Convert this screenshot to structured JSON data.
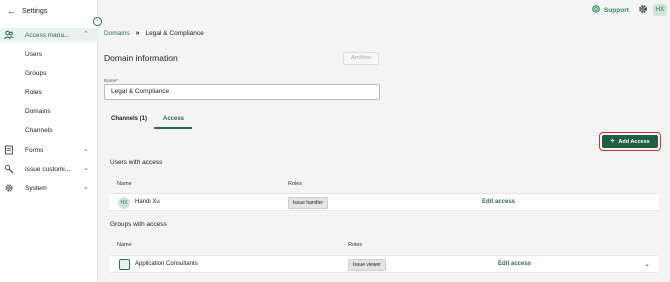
{
  "sidebar": {
    "back_label": "Settings",
    "sections": [
      {
        "label": "Access mana...",
        "icon": "users-icon",
        "expanded": true
      },
      {
        "label": "Forms",
        "icon": "forms-icon",
        "expanded": false
      },
      {
        "label": "Issue customi...",
        "icon": "tools-icon",
        "expanded": false
      },
      {
        "label": "System",
        "icon": "gear-icon",
        "expanded": false
      }
    ],
    "subitems": [
      "Users",
      "Groups",
      "Roles",
      "Domains",
      "Channels"
    ]
  },
  "topbar": {
    "support_label": "Support",
    "avatar_initials": "HX"
  },
  "breadcrumb": {
    "parent": "Domains",
    "current": "Legal & Compliance"
  },
  "page": {
    "title": "Domain information",
    "archive_label": "Archive",
    "name_label": "Name*",
    "name_value": "Legal & Compliance"
  },
  "tabs": [
    {
      "label": "Channels (1)",
      "active": false
    },
    {
      "label": "Access",
      "active": true
    }
  ],
  "add_access_label": "Add Access",
  "users_section": {
    "title": "Users with access",
    "col_name": "Name",
    "col_roles": "Roles",
    "rows": [
      {
        "initials": "HX",
        "name": "Handi Xu",
        "role": "Issue handler",
        "action": "Edit access"
      }
    ]
  },
  "groups_section": {
    "title": "Groups with access",
    "col_name": "Name",
    "col_roles": "Roles",
    "rows": [
      {
        "name": "Application Consultants",
        "role": "Issue viewer",
        "action": "Edit access"
      }
    ]
  },
  "colors": {
    "accent": "#2e6b4f",
    "button_bg": "#1f5e42",
    "highlight_border": "#d32f2f"
  }
}
